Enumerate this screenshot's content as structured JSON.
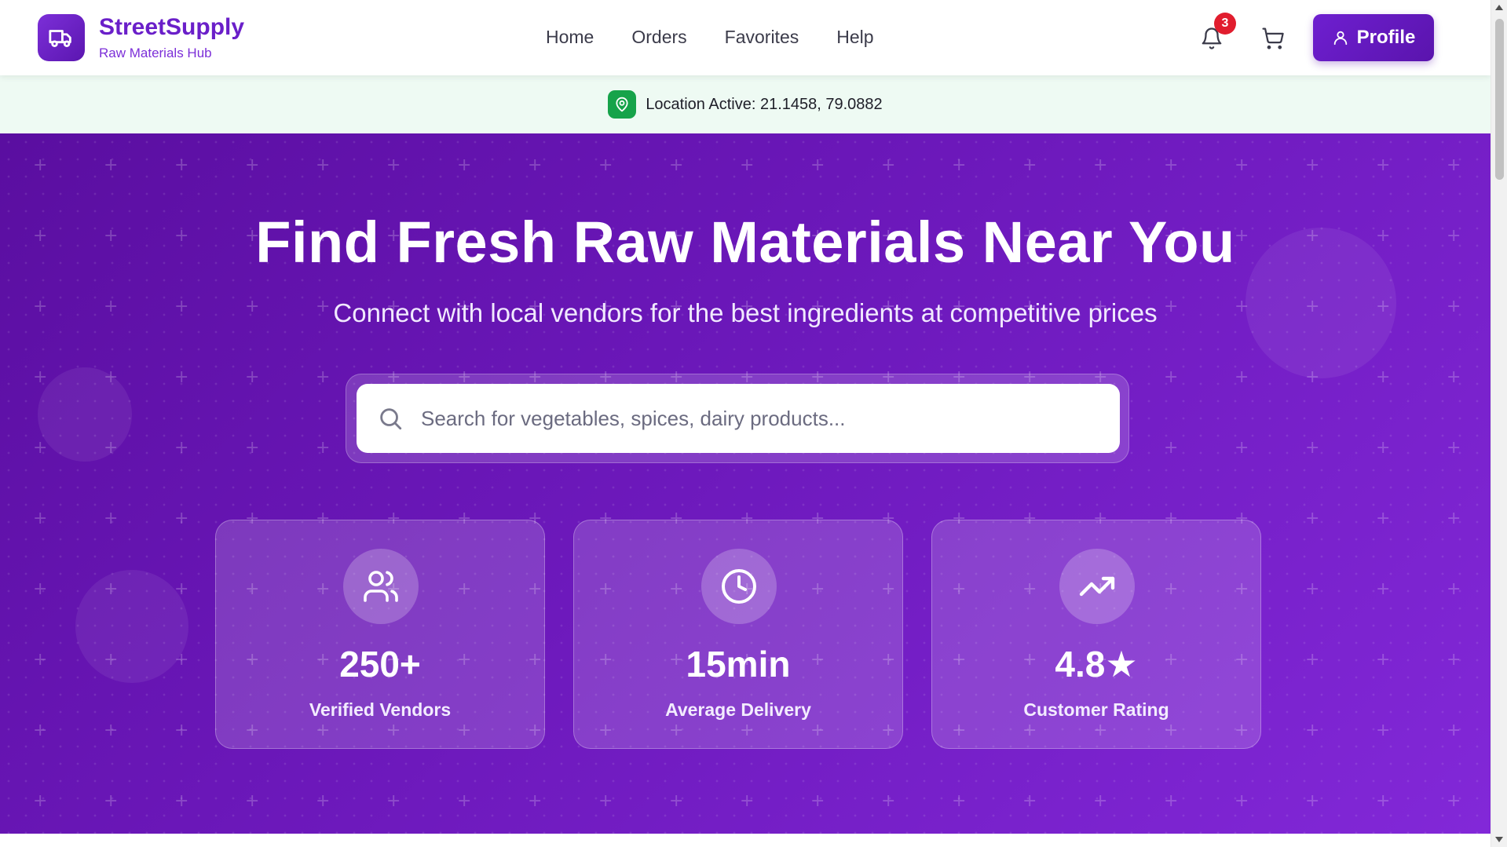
{
  "brand": {
    "name": "StreetSupply",
    "subtitle": "Raw Materials Hub",
    "logo_icon": "truck-icon"
  },
  "nav": [
    {
      "label": "Home"
    },
    {
      "label": "Orders"
    },
    {
      "label": "Favorites"
    },
    {
      "label": "Help"
    }
  ],
  "header": {
    "notifications_count": "3",
    "profile_label": "Profile"
  },
  "location": {
    "text": "Location Active: 21.1458, 79.0882"
  },
  "hero": {
    "title": "Find Fresh Raw Materials Near You",
    "subtitle": "Connect with local vendors for the best ingredients at competitive prices",
    "search_placeholder": "Search for vegetables, spices, dairy products..."
  },
  "stats": [
    {
      "icon": "users-icon",
      "value": "250+",
      "label": "Verified Vendors"
    },
    {
      "icon": "clock-icon",
      "value": "15min",
      "label": "Average Delivery"
    },
    {
      "icon": "trending-up-icon",
      "value": "4.8★",
      "label": "Customer Rating"
    }
  ],
  "colors": {
    "brand": "#6a1fc9",
    "hero_start": "#5a0ea0",
    "hero_end": "#8228d8",
    "location_active": "#16a34a",
    "badge": "#e11d2e"
  }
}
